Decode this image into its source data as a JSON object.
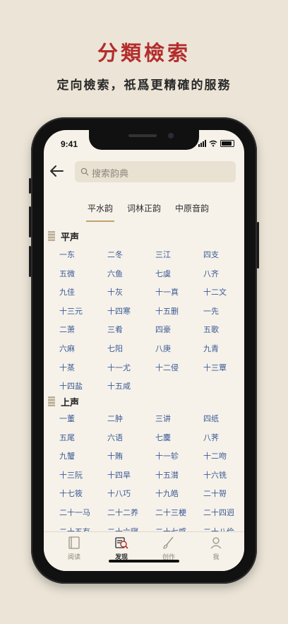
{
  "promo": {
    "headline": "分類檢索",
    "subline": "定向檢索，祇爲更精確的服務"
  },
  "status_bar": {
    "time": "9:41"
  },
  "search": {
    "placeholder": "搜索韵典"
  },
  "tabs": [
    {
      "label": "平水韵",
      "active": true
    },
    {
      "label": "词林正韵",
      "active": false
    },
    {
      "label": "中原音韵",
      "active": false
    }
  ],
  "sections": [
    {
      "title": "平声",
      "items": [
        "一东",
        "二冬",
        "三江",
        "四支",
        "五微",
        "六鱼",
        "七虞",
        "八齐",
        "九佳",
        "十灰",
        "十一真",
        "十二文",
        "十三元",
        "十四寒",
        "十五删",
        "一先",
        "二萧",
        "三肴",
        "四豪",
        "五歌",
        "六麻",
        "七阳",
        "八庚",
        "九青",
        "十蒸",
        "十一尤",
        "十二侵",
        "十三覃",
        "十四盐",
        "十五咸"
      ]
    },
    {
      "title": "上声",
      "items": [
        "一董",
        "二肿",
        "三讲",
        "四纸",
        "五尾",
        "六语",
        "七麌",
        "八荠",
        "九蟹",
        "十賄",
        "十一轸",
        "十二吻",
        "十三阮",
        "十四旱",
        "十五潸",
        "十六铣",
        "十七筱",
        "十八巧",
        "十九皓",
        "二十哿",
        "二十一马",
        "二十二养",
        "二十三梗",
        "二十四迥",
        "二十五有",
        "二十六寝",
        "二十七感",
        "二十八俭"
      ]
    }
  ],
  "bottom_tabs": [
    {
      "label": "阅读",
      "icon": "book-icon",
      "active": false
    },
    {
      "label": "发现",
      "icon": "discover-icon",
      "active": true
    },
    {
      "label": "创作",
      "icon": "brush-icon",
      "active": false
    },
    {
      "label": "我",
      "icon": "person-icon",
      "active": false
    }
  ],
  "colors": {
    "headline": "#b32d2d",
    "link": "#3b5a95",
    "accent": "#c0a26b",
    "background": "#ece5d7"
  }
}
